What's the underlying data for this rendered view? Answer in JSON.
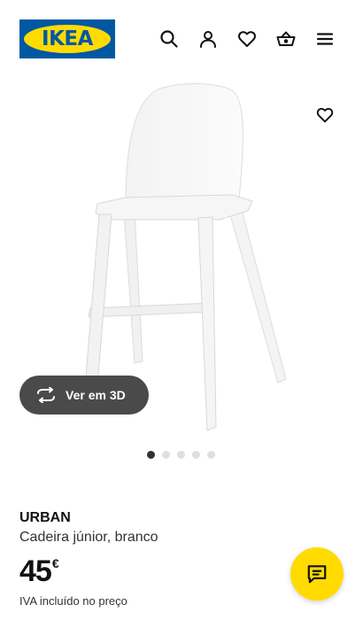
{
  "header": {
    "logo_text": "IKEA",
    "icons": [
      "search-icon",
      "account-icon",
      "heart-icon",
      "basket-icon",
      "menu-icon"
    ]
  },
  "gallery": {
    "view_3d_label": "Ver em 3D",
    "slide_count": 5,
    "active_slide": 1
  },
  "product": {
    "name": "URBAN",
    "description": "Cadeira júnior, branco",
    "price": "45",
    "currency": "€",
    "vat_note": "IVA incluído no preço"
  },
  "colors": {
    "brand_blue": "#0058a3",
    "brand_yellow": "#ffdb00",
    "button_dark": "#4a4a4a"
  }
}
